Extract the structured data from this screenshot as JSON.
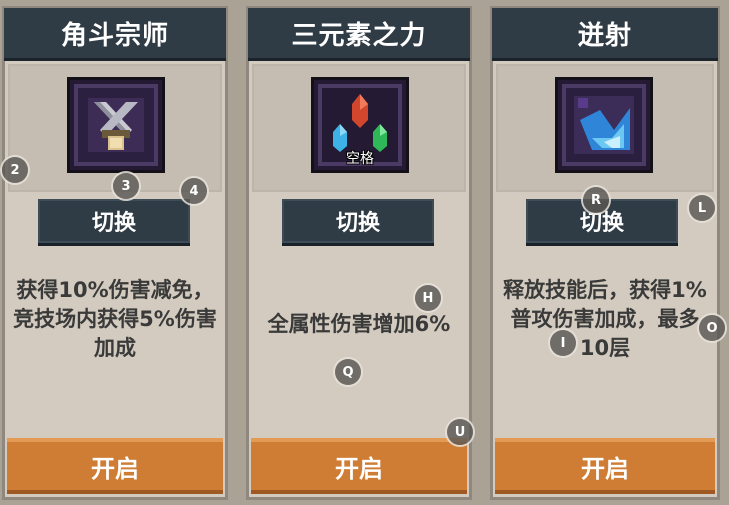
{
  "cards": [
    {
      "title": "角斗宗师",
      "icon": "crossed-swords-icon",
      "key_label": "",
      "switch_label": "切换",
      "description": "获得10%伤害减免，竞技场内获得5%伤害加成",
      "open_label": "开启"
    },
    {
      "title": "三元素之力",
      "icon": "three-crystals-icon",
      "key_label": "空格",
      "switch_label": "切换",
      "description": "全属性伤害增加6%",
      "open_label": "开启"
    },
    {
      "title": "迸射",
      "icon": "blue-shard-icon",
      "key_label": "",
      "switch_label": "切换",
      "description": "释放技能后，获得1%普攻伤害加成，最多10层",
      "open_label": "开启"
    }
  ],
  "markers": [
    "2",
    "3",
    "4",
    "H",
    "Q",
    "U",
    "R",
    "L",
    "I",
    "O"
  ],
  "colors": {
    "panel": "#d3cbbf",
    "header": "#2f3b45",
    "button_orange": "#cf7d35",
    "text_dark": "#3a3a3a"
  }
}
